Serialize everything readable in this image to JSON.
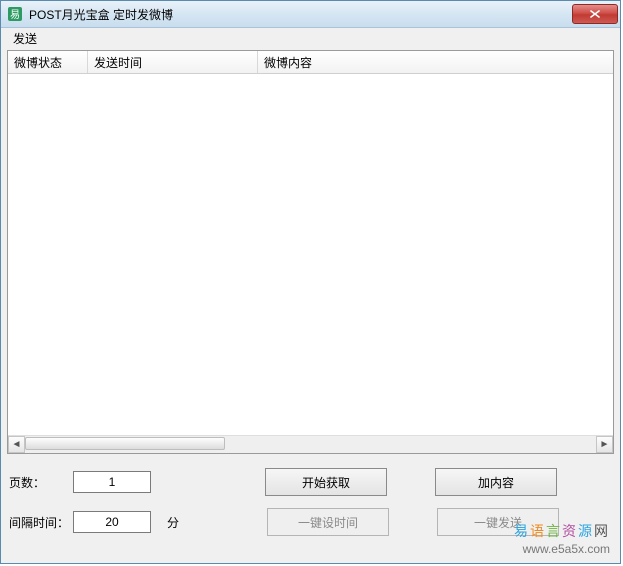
{
  "titlebar": {
    "title": "POST月光宝盒 定时发微博"
  },
  "menubar": {
    "send": "发送"
  },
  "listview": {
    "columns": {
      "status": "微博状态",
      "time": "发送时间",
      "content": "微博内容"
    }
  },
  "controls": {
    "page_label": "页数：",
    "page_value": "1",
    "interval_label": "间隔时间：",
    "interval_value": "20",
    "interval_unit": "分",
    "start_fetch": "开始获取",
    "set_time": "一键设时间",
    "add_content": "加内容",
    "send_all": "一键发送"
  },
  "watermark": {
    "line1_chars": [
      "易",
      "语",
      "言",
      "资",
      "源",
      "网"
    ],
    "line2": "www.e5a5x.com"
  }
}
